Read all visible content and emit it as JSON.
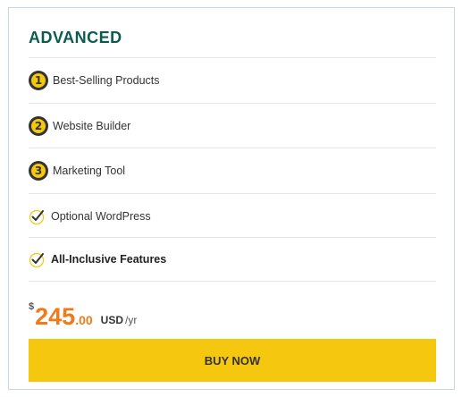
{
  "plan": {
    "title": "ADVANCED"
  },
  "features": [
    {
      "badge": "1",
      "label": "Best-Selling Products",
      "icon": "number-1-icon"
    },
    {
      "badge": "2",
      "label": "Website Builder",
      "icon": "number-2-icon"
    },
    {
      "badge": "3",
      "label": "Marketing Tool",
      "icon": "number-3-icon"
    },
    {
      "label": "Optional WordPress",
      "icon": "check-icon"
    },
    {
      "label": "All-Inclusive Features",
      "icon": "check-icon"
    }
  ],
  "price": {
    "currency": "$",
    "amount": "245",
    "cents": ".00",
    "unit": "USD",
    "period": "/yr"
  },
  "buy_button": {
    "label": "BUY NOW"
  },
  "colors": {
    "title": "#0a5c4f",
    "price": "#f07b1a",
    "button": "#f6c70f",
    "badge": "#f5c70d"
  }
}
